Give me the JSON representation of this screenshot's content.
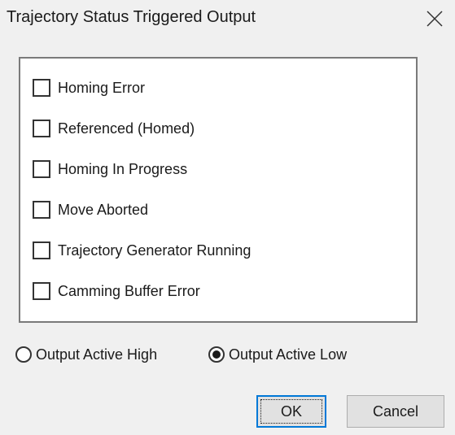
{
  "dialog": {
    "title": "Trajectory Status Triggered Output",
    "close_icon": "close-icon"
  },
  "checkboxes": [
    {
      "label": "Homing Error",
      "checked": false
    },
    {
      "label": "Referenced (Homed)",
      "checked": false
    },
    {
      "label": "Homing In Progress",
      "checked": false
    },
    {
      "label": "Move Aborted",
      "checked": false
    },
    {
      "label": "Trajectory Generator Running",
      "checked": false
    },
    {
      "label": "Camming Buffer Error",
      "checked": false
    }
  ],
  "output_mode": {
    "options": [
      {
        "label": "Output Active High",
        "selected": false
      },
      {
        "label": "Output Active Low",
        "selected": true
      }
    ]
  },
  "buttons": {
    "ok_label": "OK",
    "cancel_label": "Cancel"
  },
  "colors": {
    "background": "#f0f0f0",
    "group_background": "#ffffff",
    "focus_border": "#0078d7"
  }
}
